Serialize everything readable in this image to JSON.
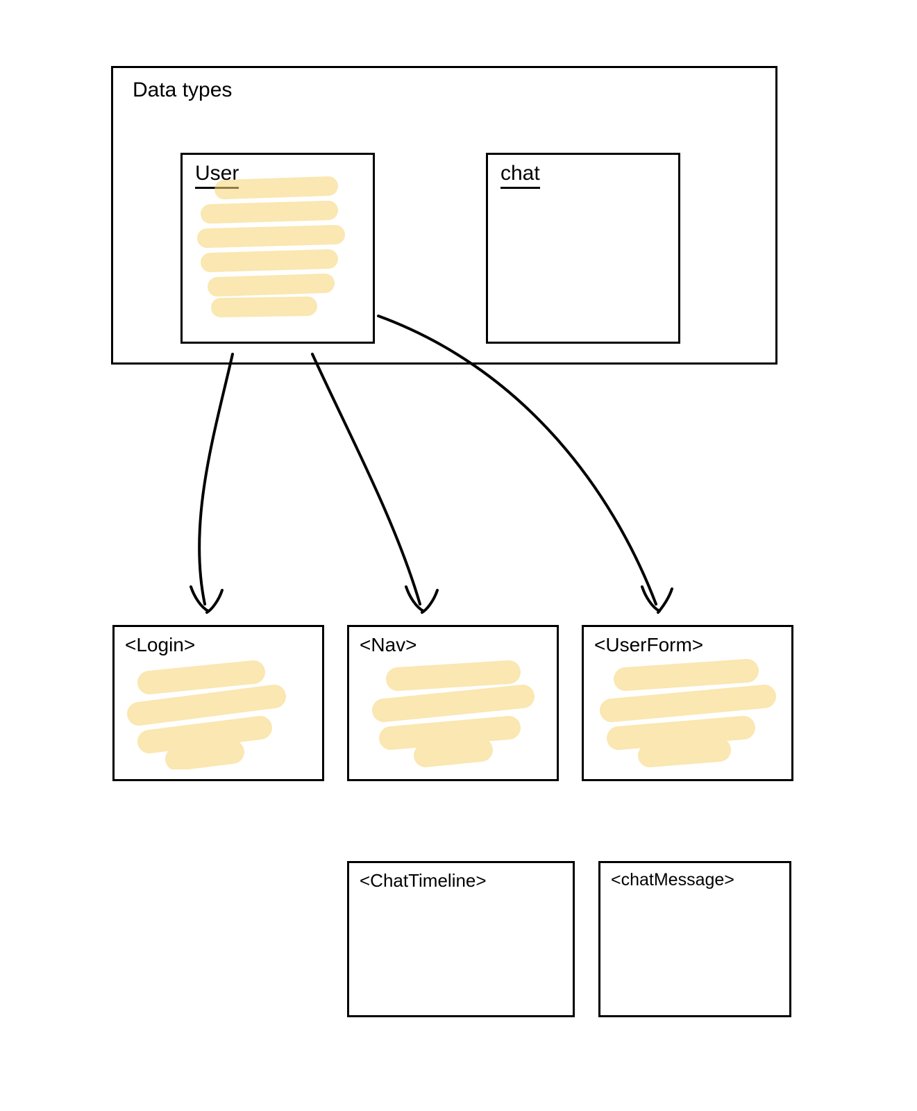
{
  "diagram": {
    "data_types_label": "Data types",
    "user_label": "User",
    "chat_label": "chat",
    "components": {
      "login": "<Login>",
      "nav": "<Nav>",
      "userform": "<UserForm>",
      "chattimeline": "<ChatTimeline>",
      "chatmessage": "<chatMessage>"
    },
    "highlight_color": "#f7d67a"
  }
}
